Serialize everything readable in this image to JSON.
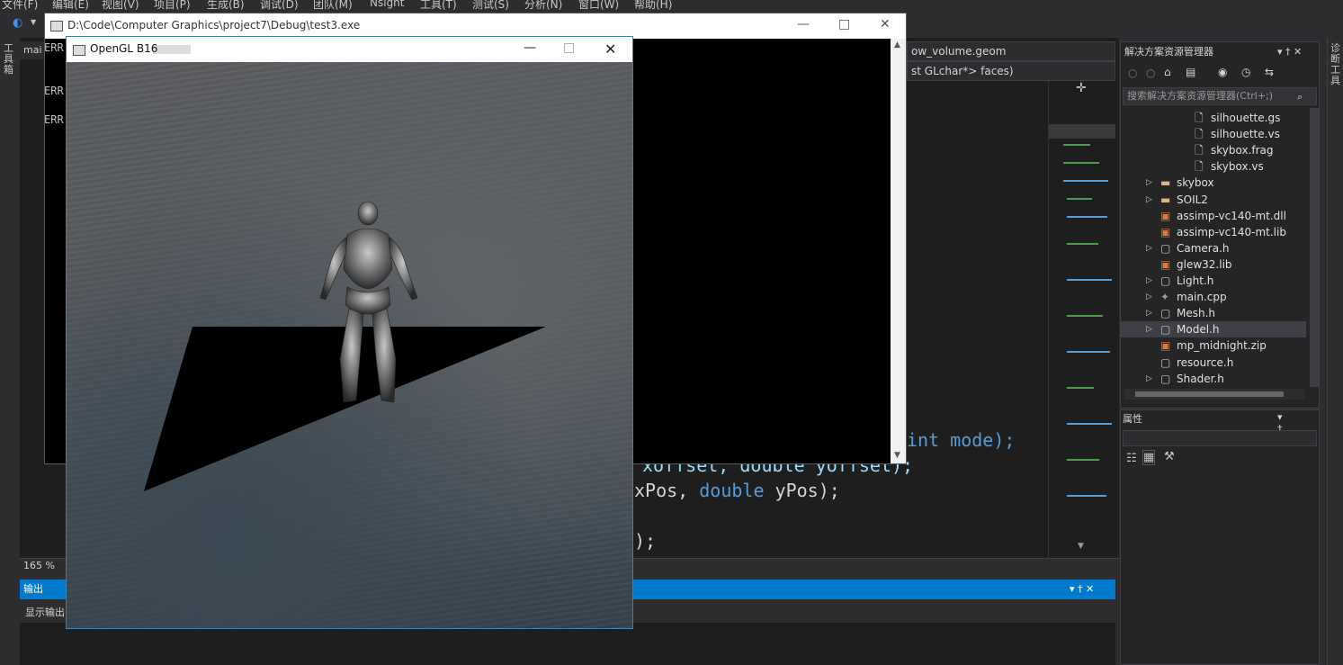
{
  "menu": [
    "文件(F)",
    "编辑(E)",
    "视图(V)",
    "项目(P)",
    "生成(B)",
    "调试(D)",
    "团队(M)",
    "Nsight",
    "工具(T)",
    "测试(S)",
    "分析(N)",
    "窗口(W)",
    "帮助(H)"
  ],
  "left_rail_label": "工具箱",
  "right_rail_label": "诊断工具",
  "editor": {
    "doc_tab": "mai",
    "nav1": "ow_volume.geom",
    "nav2": "st GLchar*> faces)",
    "line1_tail": "int mode);",
    "line2": "xoffset, double yoffset);",
    "line2_kw": "double",
    "line3_pre": "xPos, ",
    "line3_kw": "double",
    "line3_post": " yPos);",
    "line4": ");",
    "zoom": "165 %"
  },
  "output": {
    "title": "输出",
    "show_label": "显示输出"
  },
  "solution_explorer": {
    "title": "解决方案资源管理器",
    "search_placeholder": "搜索解决方案资源管理器(Ctrl+;)",
    "items": [
      {
        "label": "silhouette.gs",
        "icon": "file-icon"
      },
      {
        "label": "silhouette.vs",
        "icon": "file-icon"
      },
      {
        "label": "skybox.frag",
        "icon": "file-icon"
      },
      {
        "label": "skybox.vs",
        "icon": "file-icon"
      },
      {
        "label": "skybox",
        "icon": "folder-icon"
      },
      {
        "label": "SOIL2",
        "icon": "folder-icon"
      },
      {
        "label": "assimp-vc140-mt.dll",
        "icon": "lib-icon"
      },
      {
        "label": "assimp-vc140-mt.lib",
        "icon": "lib-icon"
      },
      {
        "label": "Camera.h",
        "icon": "header-icon"
      },
      {
        "label": "glew32.lib",
        "icon": "lib-icon"
      },
      {
        "label": "Light.h",
        "icon": "header-icon"
      },
      {
        "label": "main.cpp",
        "icon": "cpp-icon"
      },
      {
        "label": "Mesh.h",
        "icon": "header-icon"
      },
      {
        "label": "Model.h",
        "icon": "header-icon"
      },
      {
        "label": "mp_midnight.zip",
        "icon": "zip-icon"
      },
      {
        "label": "resource.h",
        "icon": "header-icon"
      },
      {
        "label": "Shader.h",
        "icon": "header-icon"
      }
    ]
  },
  "properties": {
    "title": "属性"
  },
  "console_window": {
    "title": "D:\\Code\\Computer Graphics\\project7\\Debug\\test3.exe",
    "lines": [
      "ERR",
      "ERR",
      "ERR"
    ]
  },
  "gl_window": {
    "title": "OpenGL B16"
  },
  "colors": {
    "vs_blue": "#007acc",
    "editor_bg": "#1e1e1e",
    "keyword": "#569cd6"
  }
}
